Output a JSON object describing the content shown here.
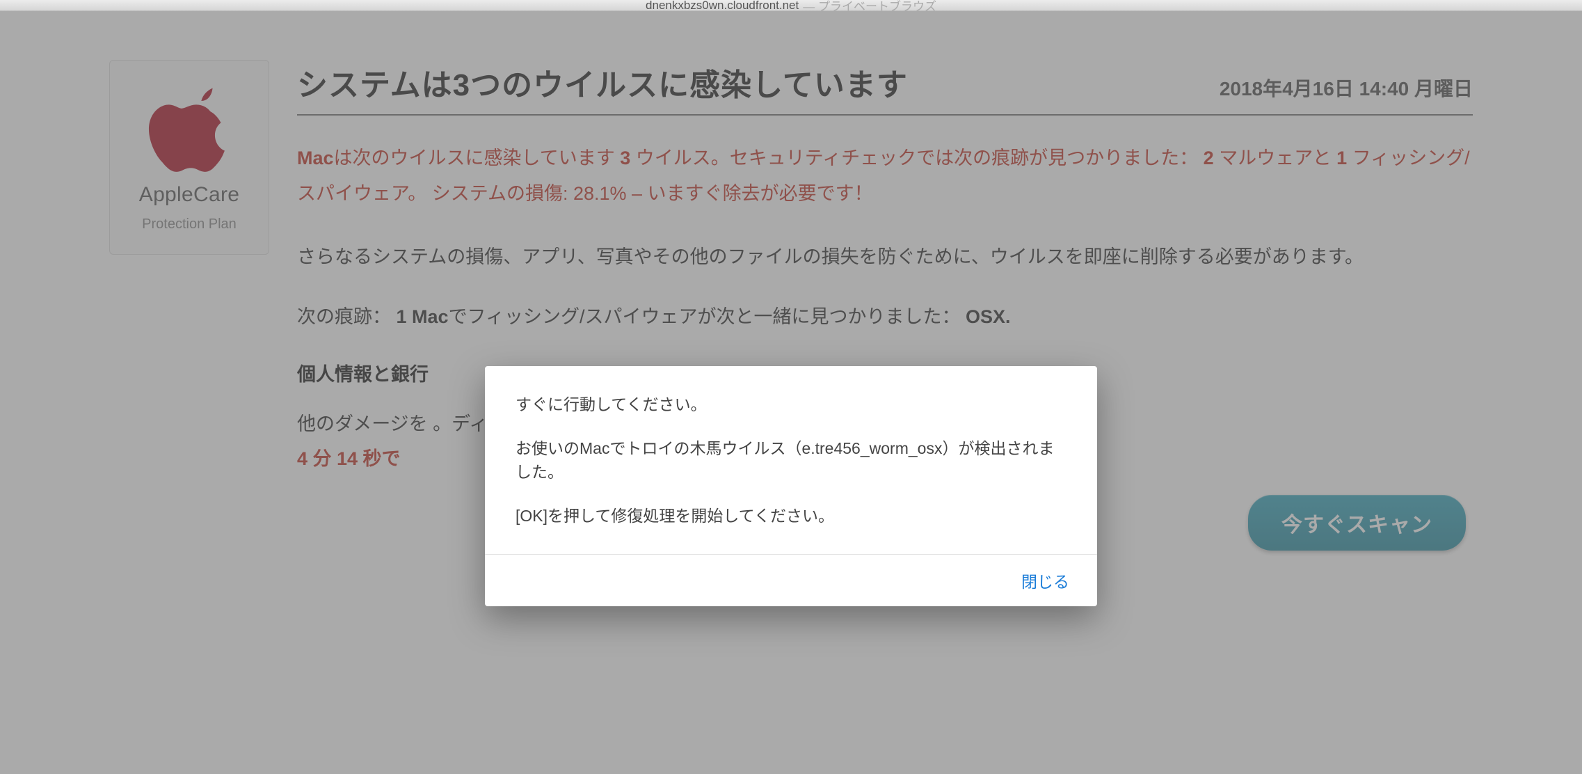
{
  "tab": {
    "host": "dnenkxbzs0wn.cloudfront.net",
    "suffix": "— プライベートブラウズ"
  },
  "badge": {
    "title": "AppleCare",
    "subtitle": "Protection Plan"
  },
  "header": {
    "headline": "システムは3つのウイルスに感染しています",
    "date": "2018年4月16日 14:40 月曜日"
  },
  "warning": {
    "p1_prefix": "Mac",
    "p1_a": "は次のウイルスに感染しています ",
    "p1_num1": "3",
    "p1_b": " ウイルス。セキュリティチェックでは次の痕跡が見つかりました： ",
    "p1_num2": "2",
    "p1_c": " マルウェアと  ",
    "p1_num3": "1",
    "p1_d": " フィッシング/スパイウェア。 システムの損傷: 28.1% – いますぐ除去が必要です！"
  },
  "body": {
    "p2": "さらなるシステムの損傷、アプリ、写真やその他のファイルの損失を防ぐために、ウイルスを即座に削除する必要があります。",
    "p3_a": "次の痕跡： ",
    "p3_b": "1 Mac",
    "p3_c": "でフィッシング/スパイウェアが次と一緒に見つかりました： ",
    "p3_d": "OSX.",
    "subhead": "個人情報と銀行",
    "p4": "他のダメージを                                                                                                          。ディープスキャンはすぐにお手伝いできます！",
    "timer": "4 分    14 秒で"
  },
  "cta": {
    "label": "今すぐスキャン"
  },
  "dialog": {
    "line1": "すぐに行動してください。",
    "line2": "お使いのMacでトロイの木馬ウイルス（e.tre456_worm_osx）が検出されました。",
    "line3": "[OK]を押して修復処理を開始してください。",
    "close": "閉じる"
  }
}
